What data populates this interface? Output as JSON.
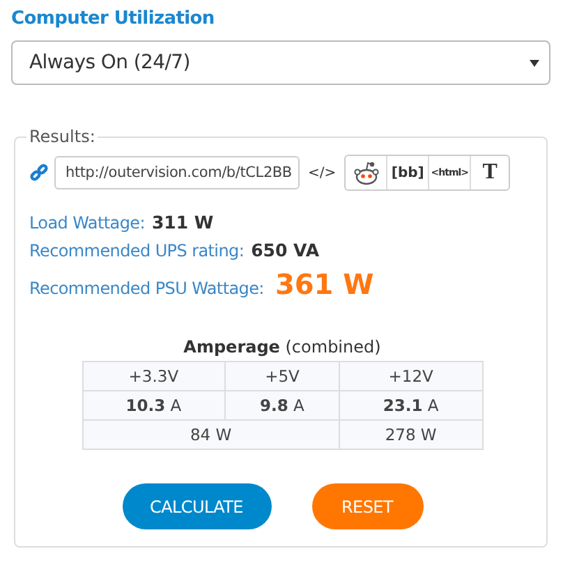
{
  "utilization": {
    "label": "Computer Utilization",
    "value": "Always On (24/7)"
  },
  "results": {
    "legend": "Results:",
    "url": "http://outervision.com/b/tCL2BB",
    "embed": "</>",
    "share": [
      {
        "kind": "reddit"
      },
      {
        "kind": "text",
        "label": "[bb]"
      },
      {
        "kind": "small",
        "label": "<html>"
      },
      {
        "kind": "serif",
        "label": "T"
      }
    ],
    "stats": [
      {
        "label": "Load Wattage:",
        "value": "311 W",
        "kind": "normal"
      },
      {
        "label": "Recommended UPS rating:",
        "value": "650 VA",
        "kind": "normal"
      },
      {
        "label": "Recommended PSU Wattage:",
        "value": "361 W",
        "kind": "highlight"
      }
    ],
    "amperage": {
      "title": "**Amperage** (combined)",
      "rails": [
        "+3.3V",
        "+5V",
        "+12V"
      ],
      "amps": [
        "**10.3** A",
        "**9.8** A",
        "**23.1** A"
      ],
      "watts": [
        "84 W",
        "278 W"
      ]
    }
  },
  "buttons": [
    {
      "label": "CALCULATE",
      "kind": "primary"
    },
    {
      "label": "RESET",
      "kind": "secondary"
    }
  ]
}
